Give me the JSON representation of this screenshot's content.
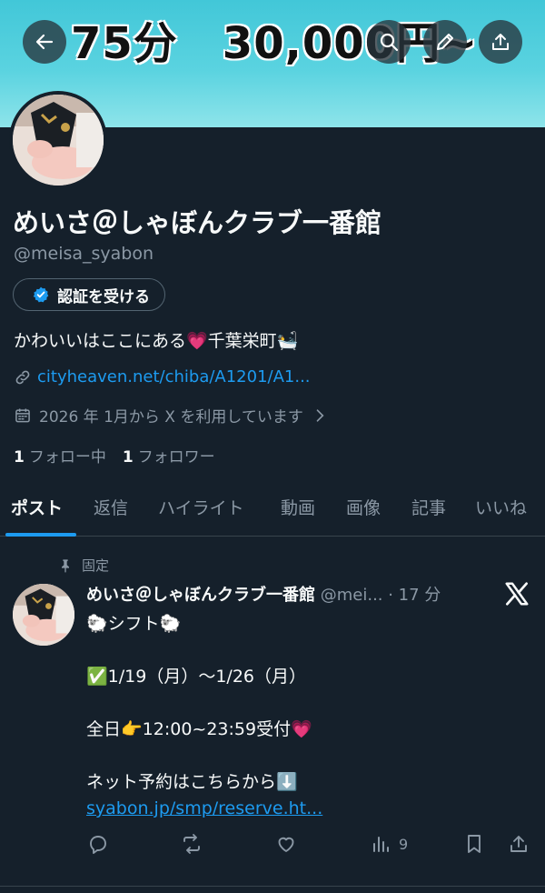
{
  "banner": {
    "text": "75分　30,000円~"
  },
  "profile": {
    "name": "めいさ＠しゃぼんクラブ一番館",
    "handle": "@meisa_syabon",
    "verify_label": "認証を受ける",
    "bio": "かわいいはここにある💗千葉栄町🛀",
    "link": "cityheaven.net/chiba/A1201/A1...",
    "joined": "2026 年 1月から X を利用しています",
    "following_count": "1",
    "following_label": "フォロー中",
    "followers_count": "1",
    "followers_label": "フォロワー"
  },
  "tabs": [
    {
      "label": "ポスト",
      "active": true
    },
    {
      "label": "返信"
    },
    {
      "label": "ハイライト"
    },
    {
      "label": "動画"
    },
    {
      "label": "画像"
    },
    {
      "label": "記事"
    },
    {
      "label": "いいね"
    }
  ],
  "post": {
    "pinned_label": "固定",
    "author": "めいさ＠しゃぼんクラブ一番館",
    "handle_time": "@mei... · 17 分",
    "lines": [
      "🐑シフト🐑",
      "",
      "✅1/19（月）〜1/26（月）",
      "",
      "全日👉12:00~23:59受付💗",
      "",
      "ネット予約はこちらから⬇️"
    ],
    "link": "syabon.jp/smp/reserve.ht...",
    "views": "9"
  },
  "icons": [
    "back-arrow-icon",
    "search-icon",
    "edit-icon",
    "share-icon",
    "verified-badge-icon",
    "link-icon",
    "calendar-icon",
    "chevron-right-icon",
    "pin-icon",
    "x-logo-icon",
    "reply-icon",
    "repost-icon",
    "like-icon",
    "views-icon",
    "bookmark-icon",
    "share-icon"
  ],
  "colors": {
    "background": "#15202b",
    "accent": "#1d9bf0",
    "muted": "#8b98a5",
    "banner": "#4fcfdc"
  }
}
